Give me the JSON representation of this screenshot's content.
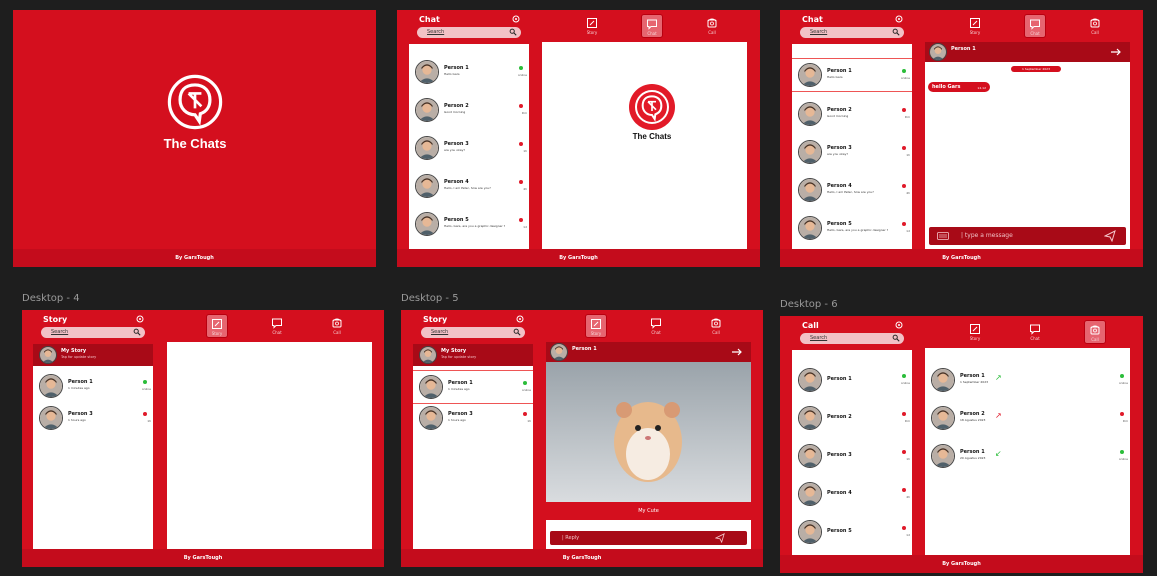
{
  "frames": {
    "f4": "Desktop - 4",
    "f5": "Desktop - 5",
    "f6": "Desktop - 6"
  },
  "app_name": "The Chats",
  "footer": "By GarsTough",
  "panels": {
    "chat": "Chat",
    "story": "Story",
    "call": "Call"
  },
  "search_label": "Search",
  "nav": {
    "story": "Story",
    "chat": "Chat",
    "call": "Call"
  },
  "contacts": [
    {
      "name": "Person 1",
      "msg": "Hello Gars",
      "status": "online"
    },
    {
      "name": "Person 2",
      "msg": "Good morning",
      "status": "Dm"
    },
    {
      "name": "Person 3",
      "msg": "are you okay?",
      "status": "1h"
    },
    {
      "name": "Person 4",
      "msg": "Hello, I am Peter, how are you?",
      "status": "4h"
    },
    {
      "name": "Person 5",
      "msg": "Hello, Gars, are you a graphic designer ?",
      "status": "1d"
    }
  ],
  "chat_view": {
    "contact": "Person 1",
    "date": "1 September 2023",
    "message": "hello Gars",
    "message_time": "12.12",
    "placeholder": "| type a message"
  },
  "story": {
    "my_story": "My Story",
    "my_story_sub": "Tap for update story",
    "items": [
      {
        "name": "Person 1",
        "time": "1 minutes ago",
        "status": "online"
      },
      {
        "name": "Person 3",
        "time": "1 hours ago",
        "status": "1h"
      }
    ],
    "caption": "My Cute",
    "reply": "| Reply"
  },
  "calls": [
    {
      "name": "Person 1",
      "date": "1 September 2023",
      "status": "online",
      "dir": "out"
    },
    {
      "name": "Person 2",
      "date": "18 Agustus 2023",
      "status": "Dm",
      "dir": "out"
    },
    {
      "name": "Person 1",
      "date": "20 Agustus 2023",
      "status": "online",
      "dir": "in"
    }
  ],
  "colors": {
    "primary": "#d40f1e",
    "dark": "#a80a17",
    "online": "#2bbd3a"
  }
}
